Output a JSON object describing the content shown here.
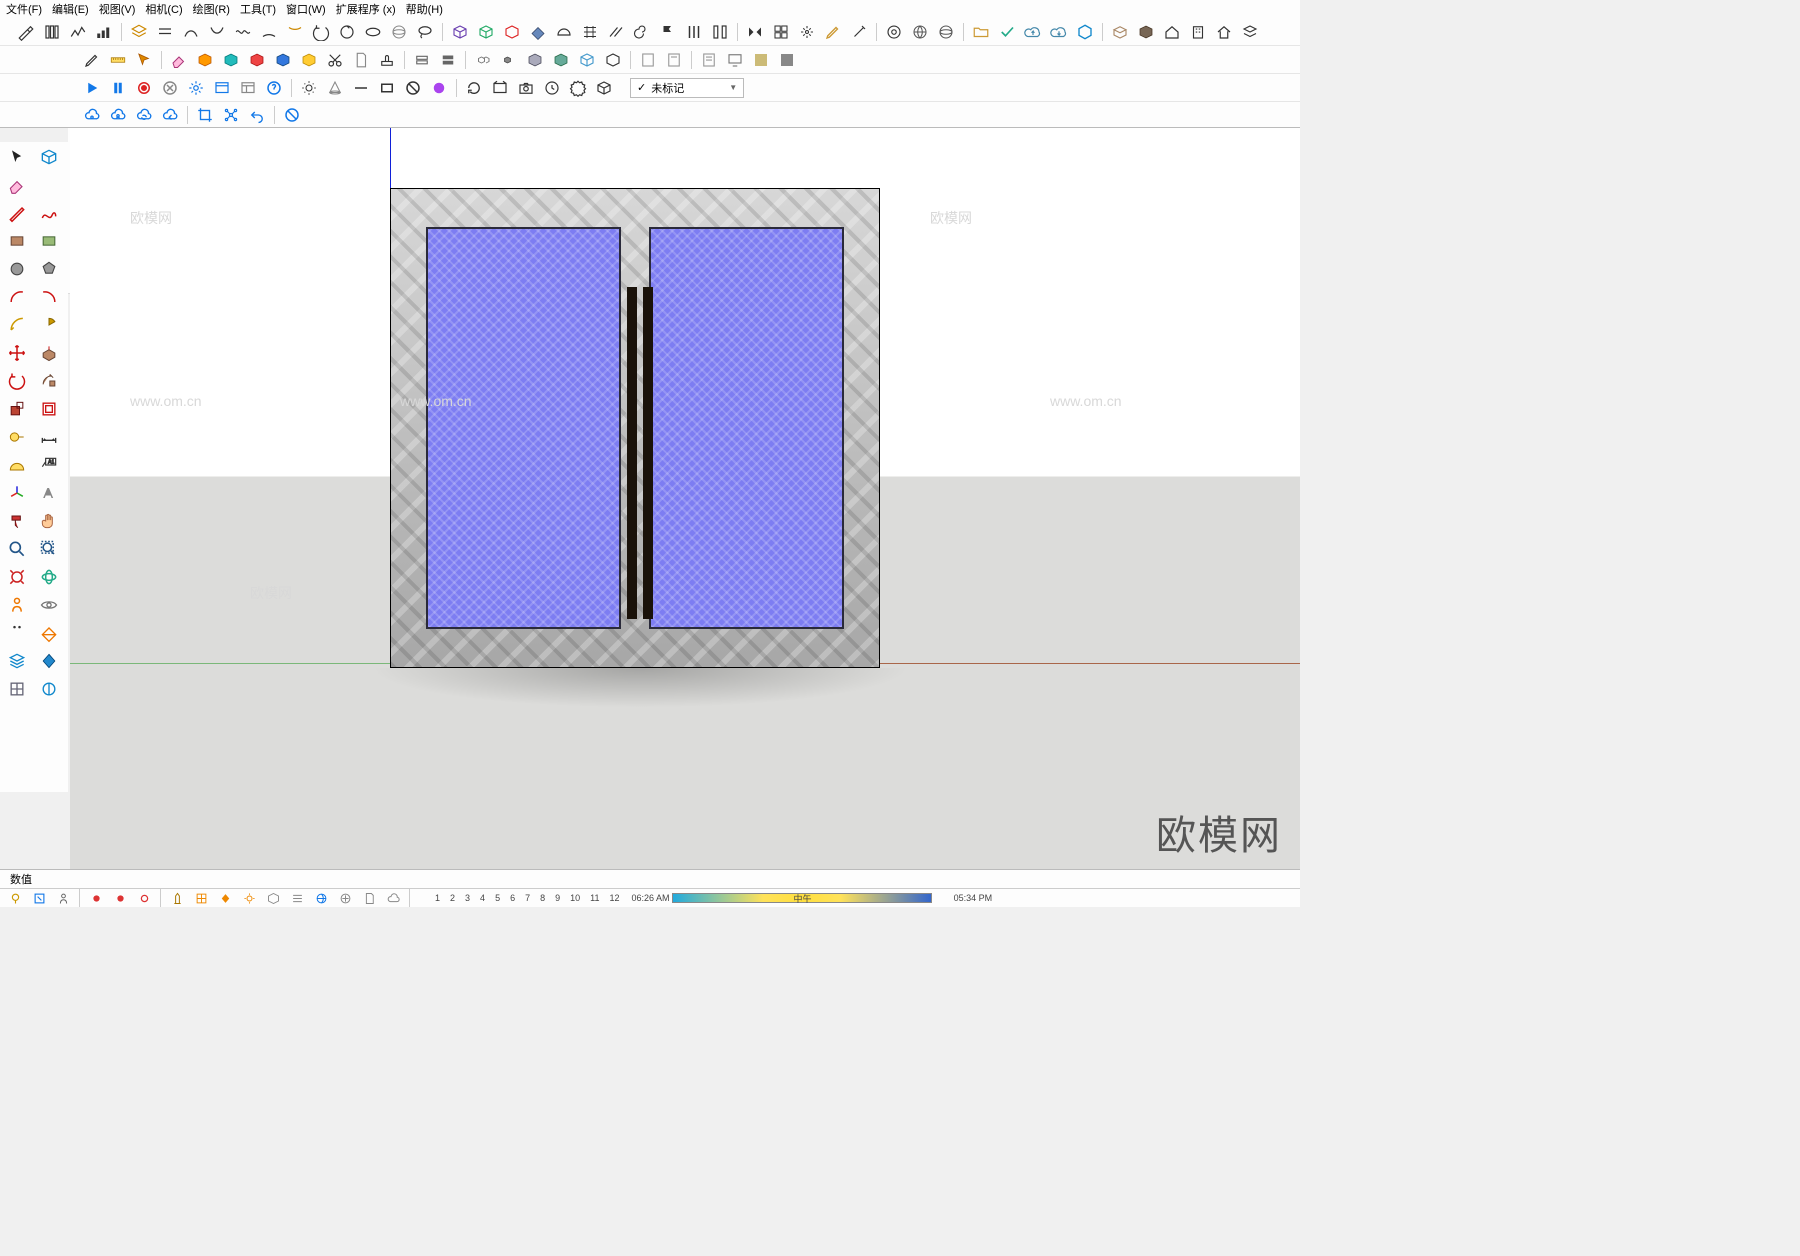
{
  "menu": {
    "file": "文件(F)",
    "edit": "编辑(E)",
    "view": "视图(V)",
    "camera": "相机(C)",
    "draw": "绘图(R)",
    "tools": "工具(T)",
    "window": "窗口(W)",
    "ext": "扩展程序 (x)",
    "help": "帮助(H)"
  },
  "tag": {
    "check": "✓",
    "label": "未标记"
  },
  "status": {
    "value_label": "数值"
  },
  "time": {
    "t1": "1",
    "t2": "2",
    "t3": "3",
    "t4": "4",
    "t5": "5",
    "t6": "6",
    "t7": "7",
    "t8": "8",
    "t9": "9",
    "t10": "10",
    "t11": "11",
    "t12": "12",
    "morning": "06:26 AM",
    "noon": "中午",
    "evening": "05:34 PM"
  },
  "brand": "欧模网",
  "wm": "欧模网",
  "wm_url": "www.om.cn"
}
